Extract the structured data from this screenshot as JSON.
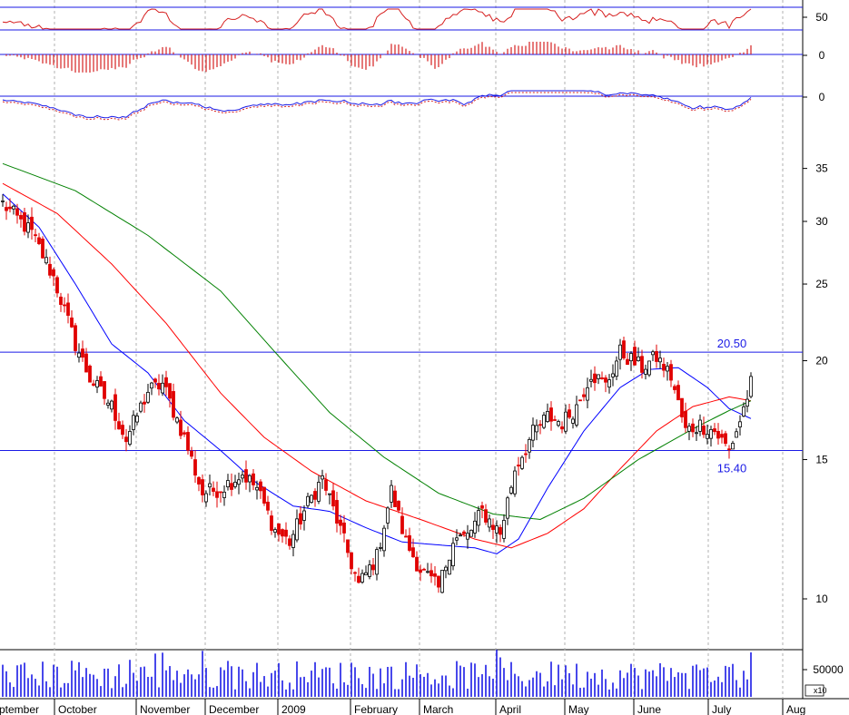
{
  "chart_data": {
    "type": "candlestick",
    "scale": "log",
    "ylim": [
      8.5,
      38
    ],
    "y_ticks": [
      10,
      15,
      20,
      25,
      30,
      35
    ],
    "x_months": [
      "ptember",
      "October",
      "November",
      "December",
      "2009",
      "February",
      "March",
      "April",
      "May",
      "June",
      "July",
      "Aug"
    ],
    "levels": [
      {
        "value": 20.5,
        "label": "20.50"
      },
      {
        "value": 15.4,
        "label": "15.40"
      }
    ],
    "keyframes": [
      [
        0,
        31.6
      ],
      [
        8,
        29
      ],
      [
        14,
        25.5
      ],
      [
        20,
        21
      ],
      [
        24,
        19
      ],
      [
        30,
        17.5
      ],
      [
        34,
        15.9
      ],
      [
        40,
        18.3
      ],
      [
        44,
        18.7
      ],
      [
        50,
        16
      ],
      [
        55,
        13.6
      ],
      [
        60,
        13.8
      ],
      [
        66,
        14.4
      ],
      [
        70,
        13.8
      ],
      [
        75,
        12.2
      ],
      [
        79,
        11.8
      ],
      [
        84,
        13.2
      ],
      [
        88,
        14.2
      ],
      [
        92,
        12.6
      ],
      [
        98,
        10.4
      ],
      [
        103,
        11.3
      ],
      [
        107,
        13.7
      ],
      [
        111,
        11.8
      ],
      [
        115,
        10.9
      ],
      [
        120,
        10.3
      ],
      [
        124,
        11.9
      ],
      [
        128,
        12
      ],
      [
        132,
        12.9
      ],
      [
        137,
        12.1
      ],
      [
        141,
        14.6
      ],
      [
        146,
        16.2
      ],
      [
        150,
        17
      ],
      [
        154,
        16.7
      ],
      [
        158,
        17.5
      ],
      [
        162,
        19.3
      ],
      [
        166,
        18.6
      ],
      [
        170,
        20.5
      ],
      [
        176,
        19.6
      ],
      [
        180,
        20.2
      ],
      [
        184,
        19.1
      ],
      [
        188,
        16.3
      ],
      [
        192,
        16.6
      ],
      [
        196,
        16.3
      ],
      [
        200,
        15.4
      ],
      [
        203,
        16.8
      ],
      [
        206,
        18.7
      ]
    ],
    "moving_averages": [
      {
        "color": "#0000ff",
        "keyframes": [
          [
            0,
            32.5
          ],
          [
            10,
            29.5
          ],
          [
            20,
            25
          ],
          [
            30,
            21
          ],
          [
            40,
            19.3
          ],
          [
            50,
            16.8
          ],
          [
            60,
            15.4
          ],
          [
            70,
            14
          ],
          [
            80,
            13.1
          ],
          [
            90,
            12.9
          ],
          [
            100,
            12.3
          ],
          [
            110,
            11.8
          ],
          [
            120,
            11.7
          ],
          [
            130,
            11.6
          ],
          [
            136,
            11.4
          ],
          [
            142,
            11.9
          ],
          [
            150,
            13.8
          ],
          [
            160,
            16.3
          ],
          [
            170,
            18.5
          ],
          [
            178,
            19.5
          ],
          [
            186,
            19.6
          ],
          [
            194,
            18.5
          ],
          [
            200,
            17.4
          ],
          [
            206,
            16.9
          ]
        ]
      },
      {
        "color": "#ff0000",
        "keyframes": [
          [
            0,
            33.5
          ],
          [
            15,
            30.7
          ],
          [
            30,
            26.5
          ],
          [
            45,
            22.3
          ],
          [
            60,
            18.2
          ],
          [
            72,
            16
          ],
          [
            85,
            14.5
          ],
          [
            100,
            13.3
          ],
          [
            115,
            12.6
          ],
          [
            130,
            11.9
          ],
          [
            140,
            11.6
          ],
          [
            150,
            12.1
          ],
          [
            160,
            13
          ],
          [
            170,
            14.6
          ],
          [
            180,
            16.3
          ],
          [
            190,
            17.5
          ],
          [
            200,
            18
          ],
          [
            206,
            17.8
          ]
        ]
      },
      {
        "color": "#008000",
        "keyframes": [
          [
            0,
            35.5
          ],
          [
            20,
            32.8
          ],
          [
            40,
            28.8
          ],
          [
            60,
            24.5
          ],
          [
            75,
            20.5
          ],
          [
            90,
            17.2
          ],
          [
            105,
            15.1
          ],
          [
            120,
            13.6
          ],
          [
            135,
            12.8
          ],
          [
            148,
            12.6
          ],
          [
            160,
            13.4
          ],
          [
            175,
            15
          ],
          [
            190,
            16.4
          ],
          [
            200,
            17.3
          ],
          [
            206,
            17.8
          ]
        ]
      }
    ],
    "osc_ticks": [
      {
        "label": "50",
        "y": 19
      },
      {
        "label": "0",
        "y": 61
      },
      {
        "label": "0",
        "y": 107
      }
    ],
    "volume_tick": "50000",
    "volume_mult": "x10"
  }
}
